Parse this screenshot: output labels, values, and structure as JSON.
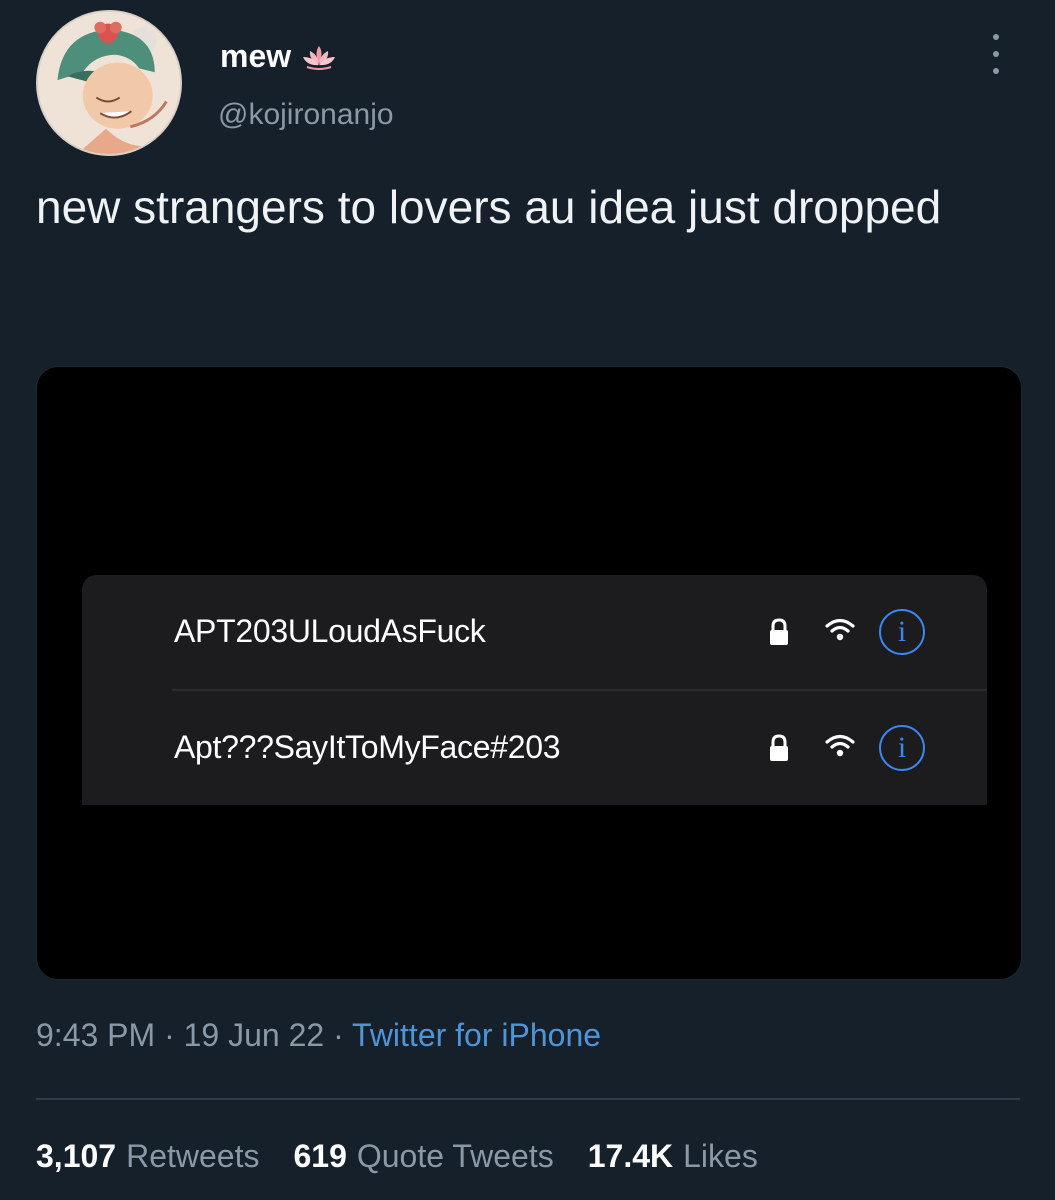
{
  "user": {
    "display_name": "mew",
    "handle": "@kojironanjo",
    "avatar_icon": "anime-character-avatar",
    "badge_icon": "lotus-icon"
  },
  "tweet": {
    "text": "new strangers to lovers au idea just dropped"
  },
  "media": {
    "networks": [
      {
        "ssid": "APT203ULoudAsFuck"
      },
      {
        "ssid": "Apt???SayItToMyFace#203"
      }
    ],
    "info_glyph": "i"
  },
  "meta": {
    "time": "9:43 PM",
    "separator": "·",
    "date": "19 Jun 22",
    "source": "Twitter for iPhone"
  },
  "stats": {
    "retweets": {
      "count": "3,107",
      "label": "Retweets"
    },
    "quotes": {
      "count": "619",
      "label": "Quote Tweets"
    },
    "likes": {
      "count": "17.4K",
      "label": "Likes"
    }
  },
  "colors": {
    "background": "#15202b",
    "accent_blue": "#3d86f2",
    "muted_text": "#8b98a5"
  }
}
